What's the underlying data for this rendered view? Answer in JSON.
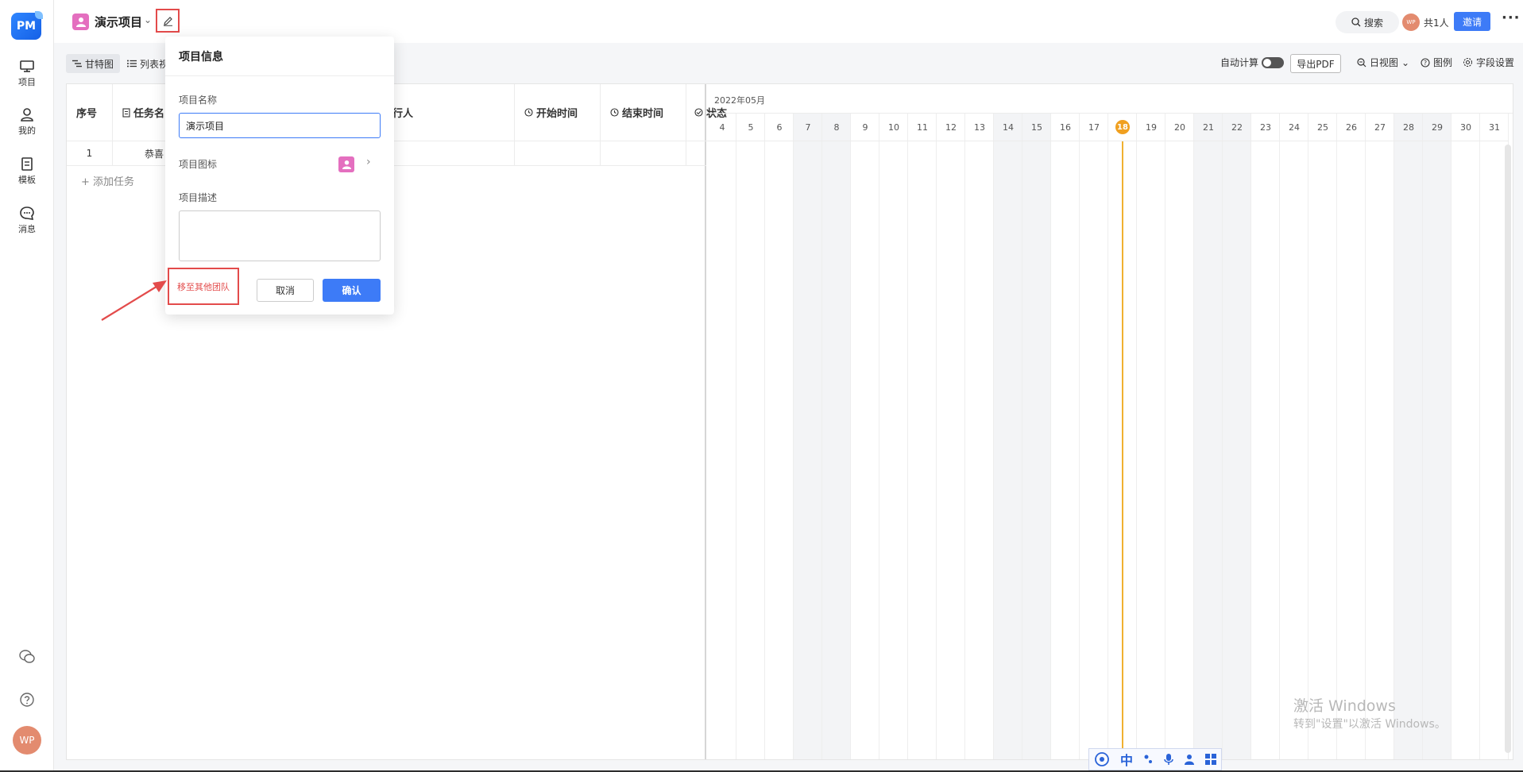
{
  "app": {
    "logo_text": "PM"
  },
  "sidebar": {
    "items": [
      {
        "label": "项目",
        "icon": "monitor-icon"
      },
      {
        "label": "我的",
        "icon": "user-icon"
      },
      {
        "label": "模板",
        "icon": "template-icon"
      },
      {
        "label": "消息",
        "icon": "message-icon"
      }
    ],
    "avatar": "WP"
  },
  "header": {
    "project_name": "演示项目",
    "search_label": "搜索",
    "member_avatar": "WP",
    "member_count": "共1人",
    "invite_label": "邀请",
    "more_label": "···"
  },
  "toolbar": {
    "view_gantt": "甘特图",
    "view_list": "列表视",
    "auto_calc": "自动计算",
    "export_pdf": "导出PDF",
    "day_view": "日视图",
    "legend": "图例",
    "field_settings": "字段设置"
  },
  "table": {
    "headers": [
      "序号",
      "任务名",
      "行人",
      "开始时间",
      "结束时间",
      "状态"
    ],
    "rows": [
      {
        "index": "1",
        "name": "恭喜"
      }
    ],
    "add_task": "+ 添加任务"
  },
  "gantt": {
    "month": "2022年05月",
    "days": [
      "4",
      "5",
      "6",
      "7",
      "8",
      "9",
      "10",
      "11",
      "12",
      "13",
      "14",
      "15",
      "16",
      "17",
      "18",
      "19",
      "20",
      "21",
      "22",
      "23",
      "24",
      "25",
      "26",
      "27",
      "28",
      "29",
      "30",
      "31"
    ],
    "weekend_days": [
      "7",
      "8",
      "14",
      "15",
      "21",
      "22",
      "28",
      "29"
    ],
    "today": "18"
  },
  "modal": {
    "title": "项目信息",
    "name_label": "项目名称",
    "name_value": "演示项目",
    "icon_label": "项目图标",
    "desc_label": "项目描述",
    "move_team": "移至其他团队",
    "cancel": "取消",
    "confirm": "确认"
  },
  "watermark": {
    "line1": "激活 Windows",
    "line2": "转到\"设置\"以激活 Windows。"
  },
  "ime": {
    "mode": "中"
  },
  "colors": {
    "accent": "#3d7bf7",
    "highlight": "#e34b4b",
    "today": "#f0a020",
    "project_icon": "#e46fbf"
  }
}
